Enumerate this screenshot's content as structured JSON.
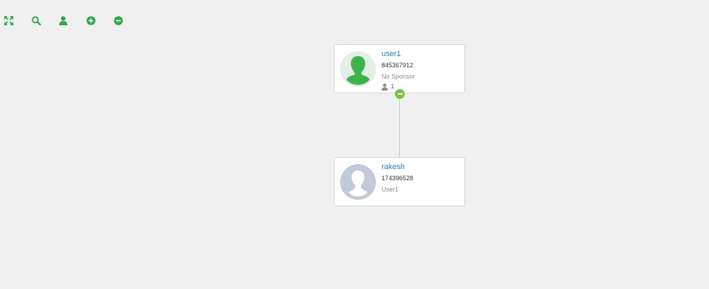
{
  "toolbar": {
    "tools": [
      {
        "icon": "fullscreen-icon",
        "color": "#2ea84a"
      },
      {
        "icon": "search-icon",
        "color": "#2ea84a"
      },
      {
        "icon": "user-icon",
        "color": "#2ea84a"
      },
      {
        "icon": "zoom-in-icon",
        "color": "#2ea84a"
      },
      {
        "icon": "zoom-out-icon",
        "color": "#2ea84a"
      }
    ]
  },
  "tree": {
    "root": {
      "name": "user1",
      "id": "845367912",
      "sponsor": "No Sponsor",
      "children_count": "1",
      "avatar_icon": "active-user-avatar-icon",
      "avatar_color": "#3db34a"
    },
    "child": {
      "name": "rakesh",
      "id": "174396528",
      "sponsor": "User1",
      "avatar_icon": "inactive-user-avatar-icon",
      "avatar_color": "#c3c9d9"
    },
    "connector_color": "#c8c8c8",
    "collapse_color": "#7dc242"
  }
}
